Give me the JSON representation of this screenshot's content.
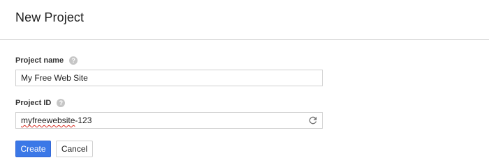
{
  "dialog": {
    "title": "New Project"
  },
  "fields": {
    "project_name": {
      "label": "Project name",
      "help_icon": "help-circle-icon",
      "value": "My Free Web Site"
    },
    "project_id": {
      "label": "Project ID",
      "help_icon": "help-circle-icon",
      "value_prefix": "myfreewebsite",
      "value_suffix": "-123",
      "action_icon": "refresh-icon"
    }
  },
  "buttons": {
    "create_label": "Create",
    "cancel_label": "Cancel"
  },
  "colors": {
    "primary": "#3b78e7",
    "help_icon": "#c6c6c6",
    "divider": "#d5d5d5"
  }
}
